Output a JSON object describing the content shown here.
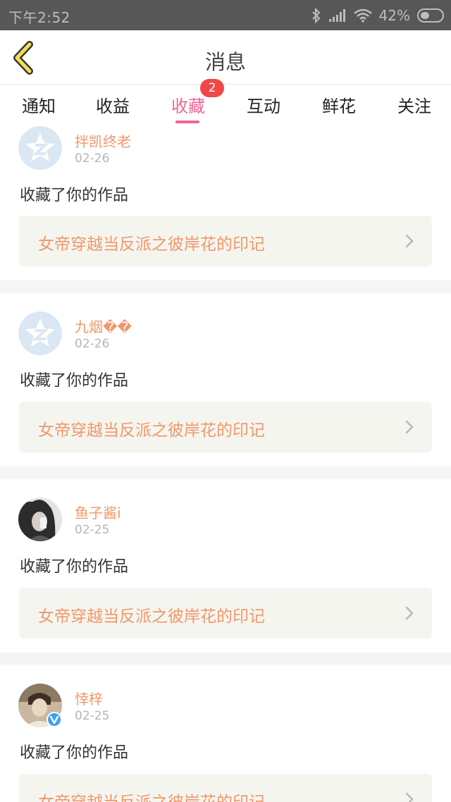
{
  "status_bar": {
    "time": "下午2:52",
    "battery_percent": "42%",
    "battery_level": 0.42
  },
  "header": {
    "title": "消息",
    "back_icon": "chevron-left-icon"
  },
  "tabs": [
    {
      "label": "通知"
    },
    {
      "label": "收益"
    },
    {
      "label": "收藏",
      "active": true,
      "badge": "2"
    },
    {
      "label": "互动"
    },
    {
      "label": "鲜花"
    },
    {
      "label": "关注"
    }
  ],
  "feed": [
    {
      "user": "拌凯终老",
      "date": "02-26",
      "action": "收藏了你的作品",
      "work": "女帝穿越当反派之彼岸花的印记",
      "avatar": "default-qzone-avatar"
    },
    {
      "user": "九烟��",
      "date": "02-26",
      "action": "收藏了你的作品",
      "work": "女帝穿越当反派之彼岸花的印记",
      "avatar": "default-qzone-avatar"
    },
    {
      "user": "鱼子酱i",
      "date": "02-25",
      "action": "收藏了你的作品",
      "work": "女帝穿越当反派之彼岸花的印记",
      "avatar": "photo-avatar"
    },
    {
      "user": "悻梓",
      "date": "02-25",
      "action": "收藏了你的作品",
      "work": "女帝穿越当反派之彼岸花的印记",
      "avatar": "photo-avatar-verified"
    }
  ],
  "colors": {
    "accent": "#f06595",
    "name": "#f0986a",
    "badge": "#f04848",
    "status_bar": "#575757"
  }
}
